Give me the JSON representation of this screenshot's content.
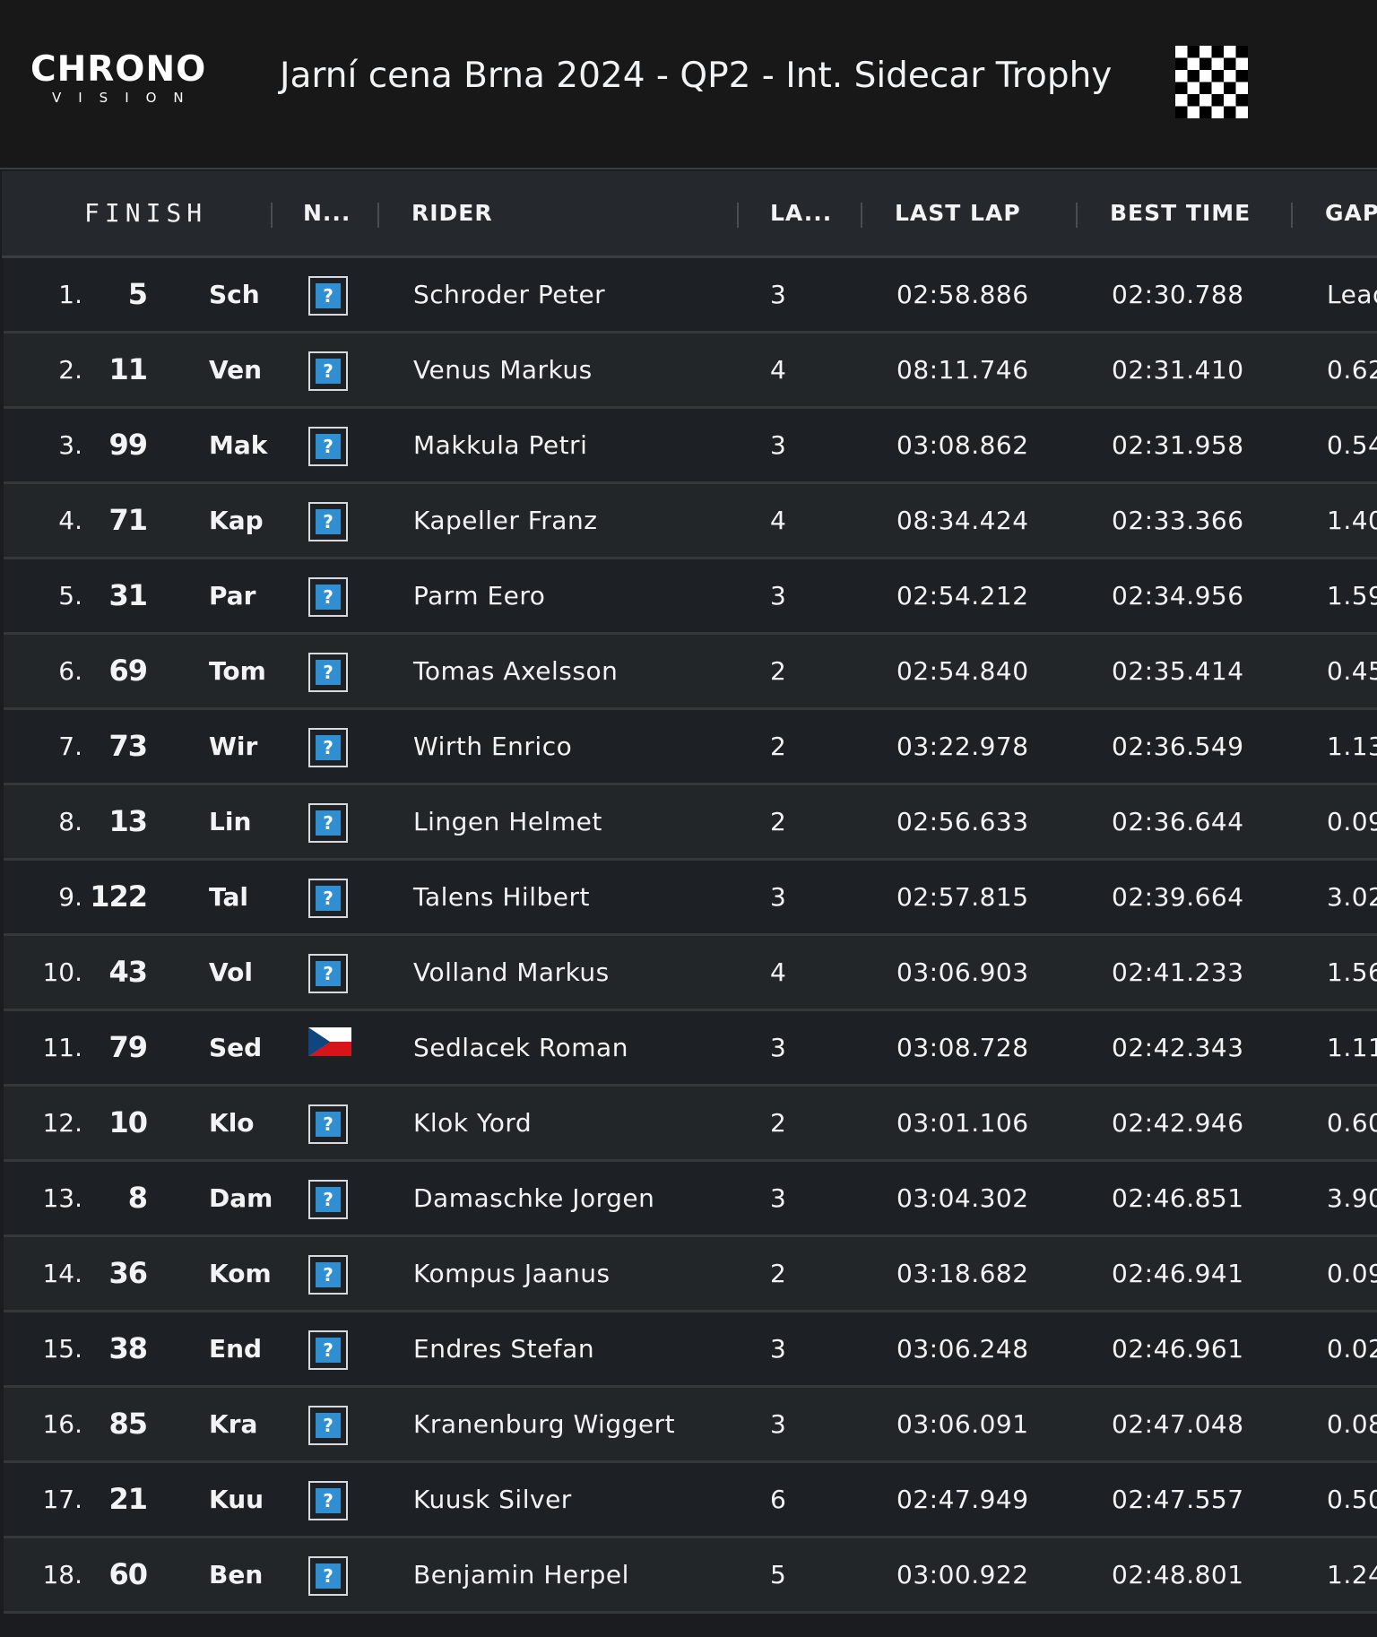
{
  "header": {
    "logo_main": "CHRONO",
    "logo_sub": "VISION",
    "title": "Jarní cena Brna 2024 - QP2 - Int. Sidecar Trophy",
    "flag_icon": "checkered-flag-icon"
  },
  "columns": {
    "finish": "FINISH",
    "nation": "N...",
    "rider": "RIDER",
    "laps": "LA...",
    "last_lap": "LAST LAP",
    "best_time": "BEST TIME",
    "gap": "GAP"
  },
  "rows": [
    {
      "pos": "1.",
      "num": "5",
      "abbr": "Sch",
      "flag": "unknown",
      "rider": "Schroder Peter",
      "laps": "3",
      "last": "02:58.886",
      "best": "02:30.788",
      "gap": "Lead"
    },
    {
      "pos": "2.",
      "num": "11",
      "abbr": "Ven",
      "flag": "unknown",
      "rider": "Venus Markus",
      "laps": "4",
      "last": "08:11.746",
      "best": "02:31.410",
      "gap": "0.62"
    },
    {
      "pos": "3.",
      "num": "99",
      "abbr": "Mak",
      "flag": "unknown",
      "rider": "Makkula Petri",
      "laps": "3",
      "last": "03:08.862",
      "best": "02:31.958",
      "gap": "0.54"
    },
    {
      "pos": "4.",
      "num": "71",
      "abbr": "Kap",
      "flag": "unknown",
      "rider": "Kapeller Franz",
      "laps": "4",
      "last": "08:34.424",
      "best": "02:33.366",
      "gap": "1.40"
    },
    {
      "pos": "5.",
      "num": "31",
      "abbr": "Par",
      "flag": "unknown",
      "rider": "Parm Eero",
      "laps": "3",
      "last": "02:54.212",
      "best": "02:34.956",
      "gap": "1.59"
    },
    {
      "pos": "6.",
      "num": "69",
      "abbr": "Tom",
      "flag": "unknown",
      "rider": "Tomas Axelsson",
      "laps": "2",
      "last": "02:54.840",
      "best": "02:35.414",
      "gap": "0.45"
    },
    {
      "pos": "7.",
      "num": "73",
      "abbr": "Wir",
      "flag": "unknown",
      "rider": "Wirth Enrico",
      "laps": "2",
      "last": "03:22.978",
      "best": "02:36.549",
      "gap": "1.13"
    },
    {
      "pos": "8.",
      "num": "13",
      "abbr": "Lin",
      "flag": "unknown",
      "rider": "Lingen Helmet",
      "laps": "2",
      "last": "02:56.633",
      "best": "02:36.644",
      "gap": "0.09"
    },
    {
      "pos": "9.",
      "num": "122",
      "abbr": "Tal",
      "flag": "unknown",
      "rider": "Talens Hilbert",
      "laps": "3",
      "last": "02:57.815",
      "best": "02:39.664",
      "gap": "3.02"
    },
    {
      "pos": "10.",
      "num": "43",
      "abbr": "Vol",
      "flag": "unknown",
      "rider": "Volland Markus",
      "laps": "4",
      "last": "03:06.903",
      "best": "02:41.233",
      "gap": "1.56"
    },
    {
      "pos": "11.",
      "num": "79",
      "abbr": "Sed",
      "flag": "cz",
      "rider": "Sedlacek Roman",
      "laps": "3",
      "last": "03:08.728",
      "best": "02:42.343",
      "gap": "1.11"
    },
    {
      "pos": "12.",
      "num": "10",
      "abbr": "Klo",
      "flag": "unknown",
      "rider": "Klok Yord",
      "laps": "2",
      "last": "03:01.106",
      "best": "02:42.946",
      "gap": "0.60"
    },
    {
      "pos": "13.",
      "num": "8",
      "abbr": "Dam",
      "flag": "unknown",
      "rider": "Damaschke Jorgen",
      "laps": "3",
      "last": "03:04.302",
      "best": "02:46.851",
      "gap": "3.90"
    },
    {
      "pos": "14.",
      "num": "36",
      "abbr": "Kom",
      "flag": "unknown",
      "rider": "Kompus Jaanus",
      "laps": "2",
      "last": "03:18.682",
      "best": "02:46.941",
      "gap": "0.09"
    },
    {
      "pos": "15.",
      "num": "38",
      "abbr": "End",
      "flag": "unknown",
      "rider": "Endres Stefan",
      "laps": "3",
      "last": "03:06.248",
      "best": "02:46.961",
      "gap": "0.02"
    },
    {
      "pos": "16.",
      "num": "85",
      "abbr": "Kra",
      "flag": "unknown",
      "rider": "Kranenburg Wiggert",
      "laps": "3",
      "last": "03:06.091",
      "best": "02:47.048",
      "gap": "0.08"
    },
    {
      "pos": "17.",
      "num": "21",
      "abbr": "Kuu",
      "flag": "unknown",
      "rider": "Kuusk Silver",
      "laps": "6",
      "last": "02:47.949",
      "best": "02:47.557",
      "gap": "0.50"
    },
    {
      "pos": "18.",
      "num": "60",
      "abbr": "Ben",
      "flag": "unknown",
      "rider": "Benjamin Herpel",
      "laps": "5",
      "last": "03:00.922",
      "best": "02:48.801",
      "gap": "1.24"
    }
  ],
  "colors": {
    "background": "#1a1c1f",
    "row_odd": "#1d2024",
    "row_even": "#232629",
    "unknown_flag": "#2f8fd1",
    "cz_red": "#d7141a",
    "cz_blue": "#11457e"
  }
}
